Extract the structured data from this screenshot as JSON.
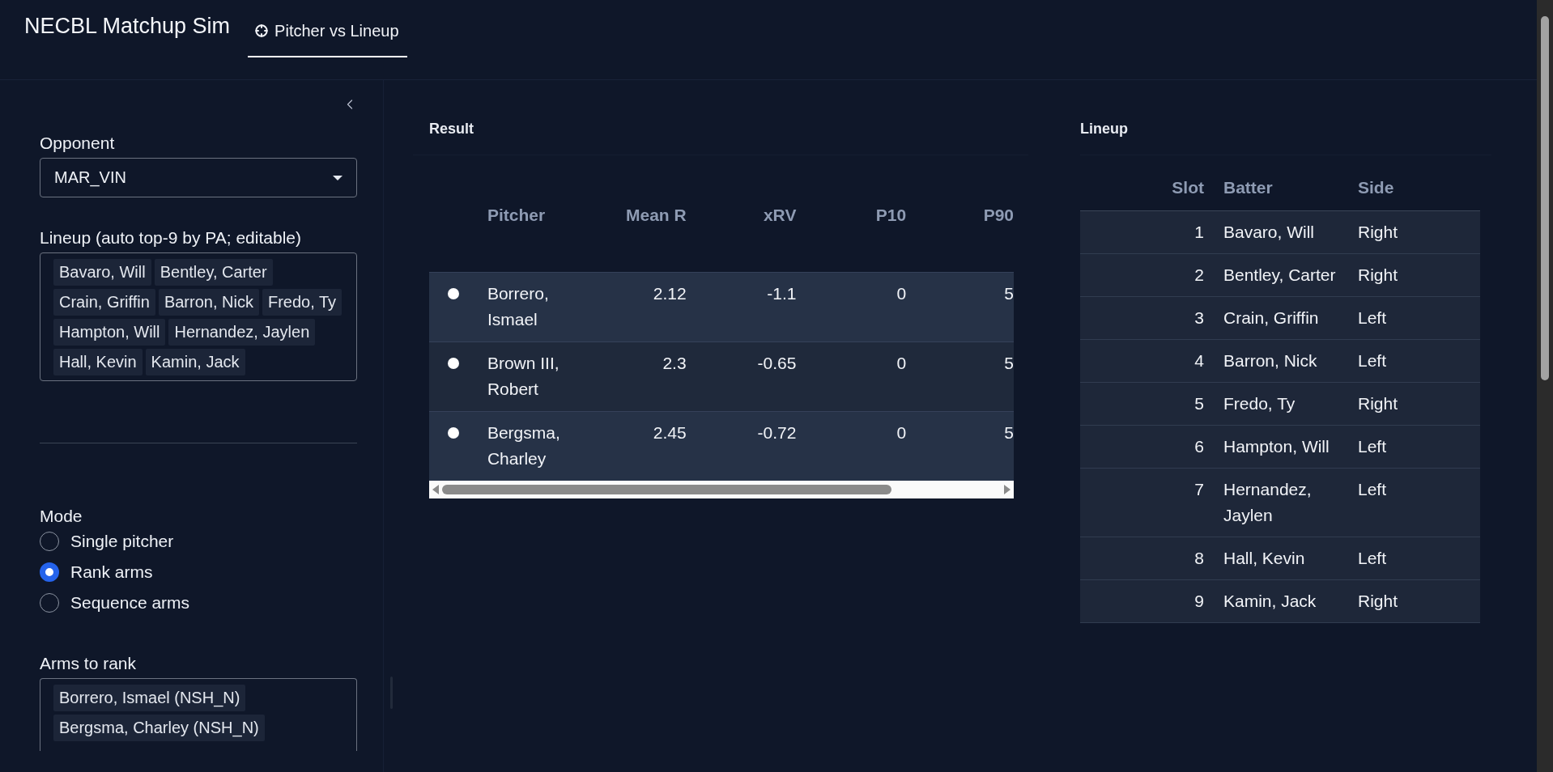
{
  "app": {
    "title": "NECBL Matchup Sim"
  },
  "tabs": [
    {
      "label": "Pitcher vs Lineup",
      "selected": true
    }
  ],
  "sidebar": {
    "opponent": {
      "label": "Opponent",
      "value": "MAR_VIN"
    },
    "lineup": {
      "label": "Lineup (auto top-9 by PA; editable)",
      "tags": [
        "Bavaro, Will",
        "Bentley, Carter",
        "Crain, Griffin",
        "Barron, Nick",
        "Fredo, Ty",
        "Hampton, Will",
        "Hernandez, Jaylen",
        "Hall, Kevin",
        "Kamin, Jack"
      ]
    },
    "mode": {
      "label": "Mode",
      "options": [
        {
          "label": "Single pitcher",
          "selected": false
        },
        {
          "label": "Rank arms",
          "selected": true
        },
        {
          "label": "Sequence arms",
          "selected": false
        }
      ]
    },
    "arms": {
      "label": "Arms to rank",
      "tags": [
        "Borrero, Ismael (NSH_N)",
        "Bergsma, Charley (NSH_N)"
      ]
    }
  },
  "result": {
    "title": "Result",
    "columns": [
      "Pitcher",
      "Mean R",
      "xRV",
      "P10",
      "P90"
    ],
    "rows": [
      {
        "selected": false,
        "cells": [
          "Borrero, Ismael",
          "2.12",
          "-1.1",
          "0",
          "5"
        ]
      },
      {
        "selected": false,
        "cells": [
          "Brown III, Robert",
          "2.3",
          "-0.65",
          "0",
          "5"
        ]
      },
      {
        "selected": false,
        "cells": [
          "Bergsma, Charley",
          "2.45",
          "-0.72",
          "0",
          "5"
        ]
      }
    ]
  },
  "lineup_panel": {
    "title": "Lineup",
    "columns": [
      "Slot",
      "Batter",
      "Side"
    ],
    "rows": [
      [
        "1",
        "Bavaro, Will",
        "Right"
      ],
      [
        "2",
        "Bentley, Carter",
        "Right"
      ],
      [
        "3",
        "Crain, Griffin",
        "Left"
      ],
      [
        "4",
        "Barron, Nick",
        "Left"
      ],
      [
        "5",
        "Fredo, Ty",
        "Right"
      ],
      [
        "6",
        "Hampton, Will",
        "Left"
      ],
      [
        "7",
        "Hernandez, Jaylen",
        "Left"
      ],
      [
        "8",
        "Hall, Kevin",
        "Left"
      ],
      [
        "9",
        "Kamin, Jack",
        "Right"
      ]
    ]
  }
}
